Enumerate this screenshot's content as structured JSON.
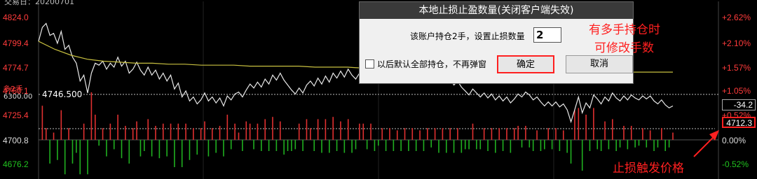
{
  "header": {
    "info_text": "交易日：20200701"
  },
  "price_labels": [
    {
      "text": "4824.0",
      "cls": ""
    },
    {
      "text": "4799.4",
      "cls": ""
    },
    {
      "text": "4774.7",
      "cls": ""
    },
    {
      "text": "4750.1",
      "cls": ""
    },
    {
      "text": "4725.4",
      "cls": ""
    },
    {
      "text": "4700.8",
      "cls": "neutral"
    },
    {
      "text": "4676.2",
      "cls": "down"
    }
  ],
  "pct_labels": [
    {
      "text": "+2.62%",
      "cls": ""
    },
    {
      "text": "+2.10%",
      "cls": ""
    },
    {
      "text": "+1.57%",
      "cls": ""
    },
    {
      "text": "+1.05%",
      "cls": ""
    },
    {
      "text": "+0.52%",
      "cls": ""
    },
    {
      "text": "0.00%",
      "cls": "neutral"
    },
    {
      "text": "-0.52%",
      "cls": "down"
    }
  ],
  "position": {
    "tag": "多2手",
    "open_price": "6300.00",
    "stop_line_price": "4746.500"
  },
  "right_boxes": {
    "value_a": "-34.2",
    "value_b": "4712.3"
  },
  "dialog": {
    "title": "本地止损止盈数量(关闭客户端失效)",
    "message": "该账户持仓2手，设置止损数量",
    "quantity": "2",
    "checkbox_label": "以后默认全部持仓，不再弹窗",
    "ok_label": "确定",
    "cancel_label": "取消"
  },
  "annotations": {
    "top_line1": "有多手持仓时",
    "top_line2": "可修改手数",
    "bottom": "止损触发价格"
  },
  "colors": {
    "price_line": "#e8e8e8",
    "avg_line": "#c8c040",
    "up_bar": "#e03030",
    "down_bar": "#20b020",
    "annotation": "#ff2020"
  },
  "chart_data": {
    "type": "line",
    "ylim": [
      4676.2,
      4824.0
    ],
    "series": [
      {
        "values": [
          4800,
          4814,
          4818,
          4806,
          4808,
          4798,
          4810,
          4792,
          4796,
          4784,
          4778,
          4760,
          4766,
          4748,
          4768,
          4778,
          4776,
          4780,
          4772,
          4778,
          4774,
          4784,
          4775,
          4780,
          4768,
          4772,
          4779,
          4771,
          4766,
          4774,
          4766,
          4771,
          4762,
          4768,
          4760,
          4766,
          4752,
          4758,
          4744,
          4750,
          4740,
          4744,
          4737,
          4741,
          4748,
          4740,
          4744,
          4738,
          4743,
          4735,
          4745,
          4741,
          4747,
          4749,
          4744,
          4751,
          4757,
          4753,
          4759,
          4754,
          4762,
          4757,
          4766,
          4761,
          4768,
          4761,
          4756,
          4751,
          4747,
          4753,
          4748,
          4756,
          4760,
          4755,
          4763,
          4757,
          4765,
          4759,
          4768,
          4763,
          4770,
          4764,
          4772,
          4766,
          4762,
          4768,
          4774,
          4770,
          4776,
          4771,
          4769,
          4773,
          4768,
          4772,
          4767,
          4770,
          4765,
          4769,
          4764,
          4768,
          4763,
          4766,
          4761,
          4765,
          4762,
          4766,
          4760,
          4764,
          4758,
          4762,
          4756,
          4760,
          4754,
          4750,
          4746,
          4752,
          4748,
          4744,
          4748,
          4743,
          4747,
          4741,
          4745,
          4740,
          4744,
          4738,
          4742,
          4747,
          4744,
          4749,
          4746,
          4741,
          4744,
          4739,
          4735,
          4739,
          4735,
          4739,
          4734,
          4737,
          4731,
          4719,
          4731,
          4744,
          4728,
          4738,
          4733,
          4746,
          4742,
          4737,
          4744,
          4740,
          4748,
          4743,
          4740,
          4745,
          4741,
          4746,
          4743,
          4741,
          4745,
          4742,
          4745,
          4740,
          4737,
          4741,
          4736,
          4733,
          4735
        ]
      },
      {
        "values": [
          4800,
          4792,
          4786,
          4782,
          4780,
          4779,
          4778,
          4778,
          4777,
          4777,
          4776,
          4776,
          4776,
          4775,
          4775,
          4775,
          4775,
          4774,
          4774,
          4774,
          4773,
          4773,
          4773,
          4773,
          4772,
          4772,
          4772,
          4772,
          4771,
          4771,
          4771,
          4771,
          4770,
          4770,
          4770,
          4770,
          4769,
          4769,
          4769,
          4769
        ]
      }
    ]
  }
}
